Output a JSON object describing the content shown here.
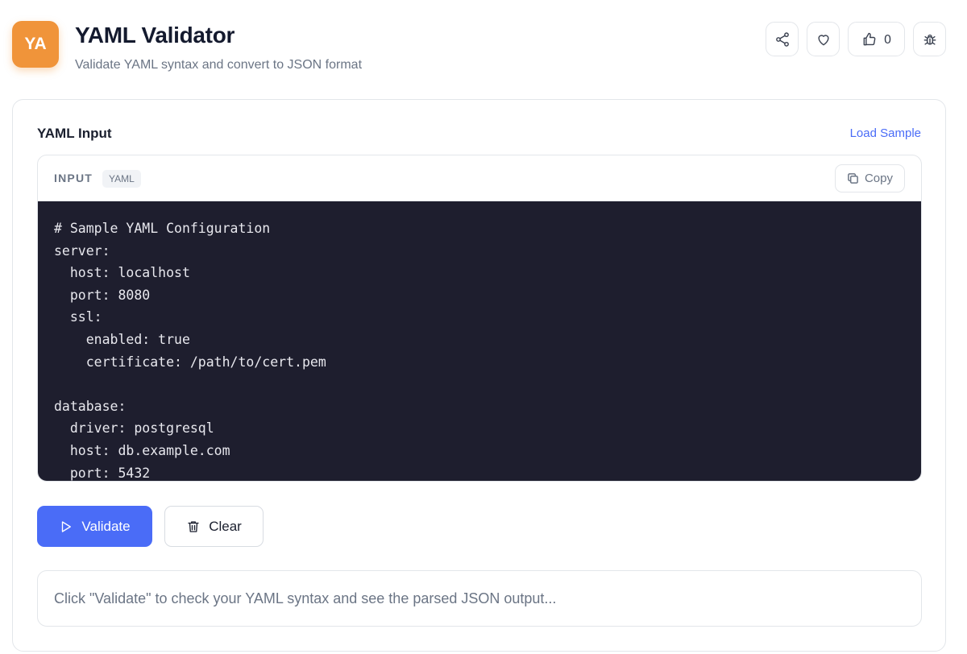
{
  "header": {
    "logo_text": "YA",
    "title": "YAML Validator",
    "subtitle": "Validate YAML syntax and convert to JSON format",
    "like_count": "0",
    "buttons": [
      "share-icon",
      "heart-icon",
      "thumbs-up-icon",
      "bug-icon"
    ]
  },
  "main": {
    "section_label": "YAML Input",
    "load_sample_label": "Load Sample",
    "editor": {
      "label": "INPUT",
      "language_badge": "YAML",
      "copy_label": "Copy",
      "lines": [
        "# Sample YAML Configuration",
        "server:",
        "  host: localhost",
        "  port: 8080",
        "  ssl:",
        "    enabled: true",
        "    certificate: /path/to/cert.pem",
        "",
        "database:",
        "  driver: postgresql",
        "  host: db.example.com",
        "  port: 5432"
      ]
    },
    "validate_label": "Validate",
    "clear_label": "Clear",
    "output_placeholder": "Click \"Validate\" to check your YAML syntax and see the parsed JSON output..."
  },
  "colors": {
    "accent": "#4a6cf7",
    "logo": "#f0943a",
    "code_bg": "#1e1e2e"
  }
}
